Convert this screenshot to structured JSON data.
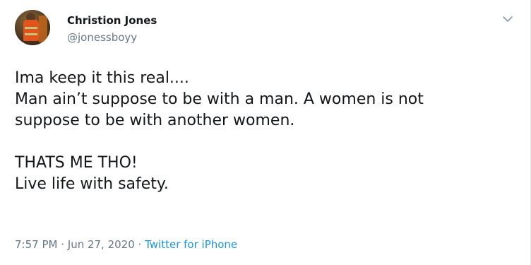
{
  "author": {
    "name": "Christion Jones",
    "handle": "@jonessboyy",
    "avatar_icon": "profile-photo"
  },
  "tweet": {
    "lines": [
      "Ima keep it this real....",
      "Man ain’t suppose to be with a man. A women is not",
      "suppose to be with another women.",
      "",
      "THATS ME THO!",
      "Live life with safety."
    ]
  },
  "meta": {
    "time": "7:57 PM",
    "separator1": " · ",
    "date": "Jun 27, 2020",
    "separator2": " · ",
    "source": "Twitter for iPhone"
  },
  "menu": {
    "icon": "chevron-down-icon"
  },
  "colors": {
    "text": "#14171a",
    "secondary": "#657786",
    "link": "#1b95e0",
    "border": "#e6ecf0"
  }
}
